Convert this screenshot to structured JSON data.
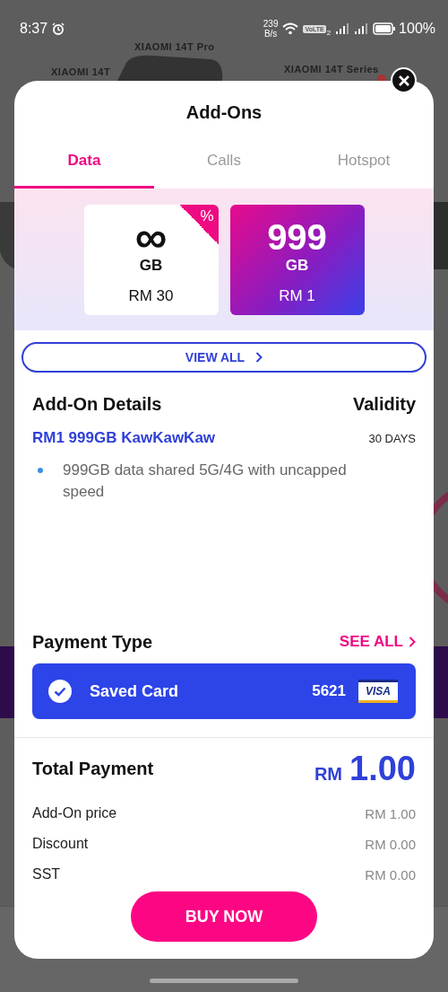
{
  "status_bar": {
    "time": "8:37",
    "net_speed_value": "239",
    "net_speed_unit": "B/s",
    "volte_label": "VoLTE",
    "sim_label": "2",
    "battery": "100%"
  },
  "background": {
    "banner_texts": [
      "XIAOMI 14T Pro",
      "XIAOMI 14T",
      "XIAOMI 14T Series"
    ]
  },
  "sheet": {
    "title": "Add-Ons",
    "tabs": [
      {
        "label": "Data",
        "selected": true
      },
      {
        "label": "Calls",
        "selected": false
      },
      {
        "label": "Hotspot",
        "selected": false
      }
    ],
    "plans": [
      {
        "amount": "∞",
        "unit": "GB",
        "price": "RM 30",
        "badge": "%",
        "selected": false
      },
      {
        "amount": "999",
        "unit": "GB",
        "price": "RM 1",
        "selected": true
      }
    ],
    "view_all": "VIEW ALL",
    "details_heading": "Add-On Details",
    "validity_heading": "Validity",
    "addon_name": "RM1 999GB KawKawKaw",
    "validity": "30 DAYS",
    "features": [
      "999GB data shared 5G/4G with uncapped speed"
    ],
    "payment_heading": "Payment Type",
    "see_all": "SEE ALL",
    "payment_method": {
      "label": "Saved Card",
      "last_digits": "5621",
      "brand": "VISA",
      "selected": true
    },
    "total_label": "Total Payment",
    "total_currency": "RM",
    "total_amount": "1.00",
    "breakdown": [
      {
        "label": "Add-On price",
        "value": "RM 1.00"
      },
      {
        "label": "Discount",
        "value": "RM 0.00"
      },
      {
        "label": "SST",
        "value": "RM 0.00"
      }
    ],
    "buy_button": "BUY NOW"
  }
}
